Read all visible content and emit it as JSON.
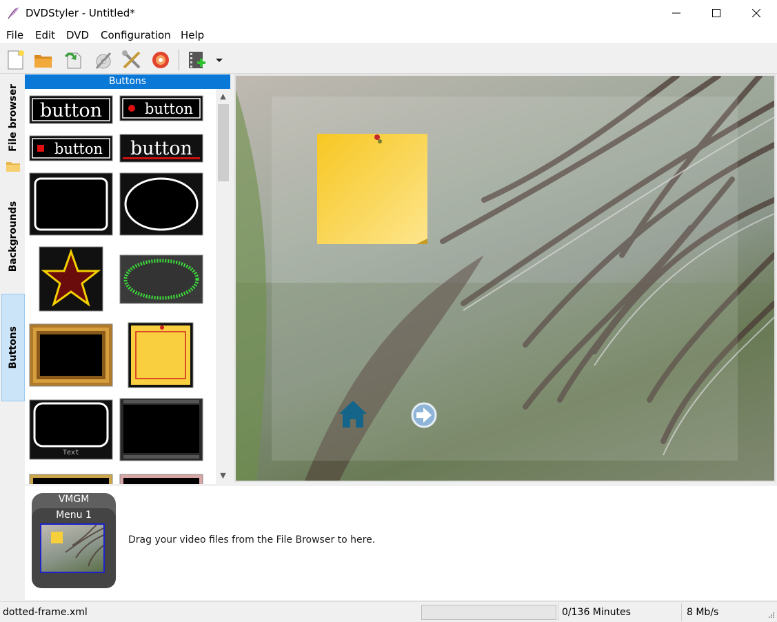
{
  "window": {
    "title": "DVDStyler - Untitled*"
  },
  "menu": [
    "File",
    "Edit",
    "DVD",
    "Configuration",
    "Help"
  ],
  "tabs": [
    "File browser",
    "Backgrounds",
    "Buttons"
  ],
  "panel": {
    "title": "Buttons"
  },
  "thumbs": {
    "button_text": "button",
    "frame_text": "Text"
  },
  "titleset": {
    "vmgm": "VMGM",
    "menu": "Menu 1"
  },
  "hint": "Drag your video files from the File Browser to here.",
  "status": {
    "file": "dotted-frame.xml",
    "minutes": "0/136 Minutes",
    "bitrate": "8 Mb/s"
  },
  "colors": {
    "accent": "#0a78d7",
    "tab_selected": "#cce4f7",
    "note": "#f9cf3f"
  }
}
